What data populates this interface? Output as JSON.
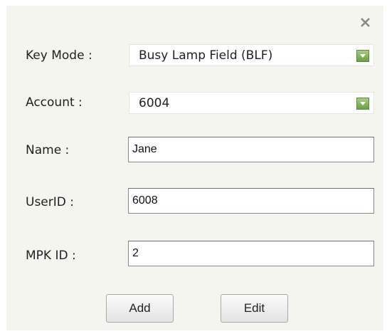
{
  "dialog": {
    "close_icon": "close-icon",
    "key_mode": {
      "label": "Key Mode :",
      "value": "Busy Lamp Field (BLF)"
    },
    "account": {
      "label": "Account :",
      "value": "6004"
    },
    "name": {
      "label": "Name :",
      "value": "Jane"
    },
    "userid": {
      "label": "UserID :",
      "value": "6008"
    },
    "mpk_id": {
      "label": "MPK ID :",
      "value": "2"
    },
    "buttons": {
      "add": "Add",
      "edit": "Edit"
    },
    "colors": {
      "background": "#f5f5ef",
      "dropdown_arrow": "#8bb863"
    }
  }
}
